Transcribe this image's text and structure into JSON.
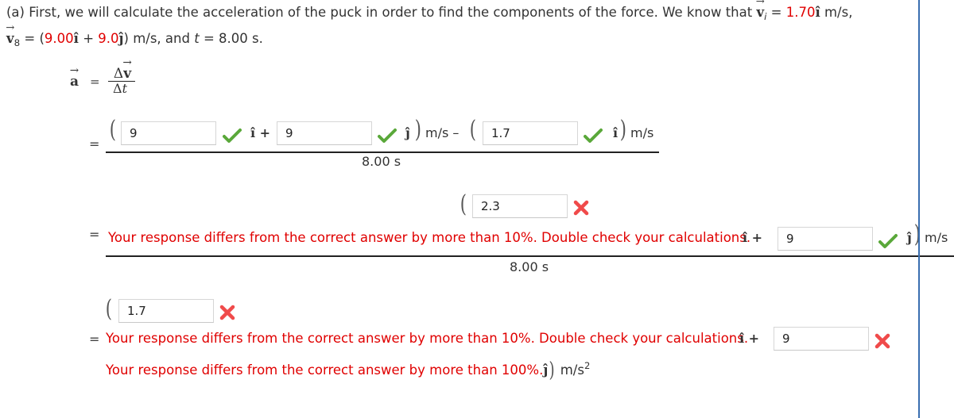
{
  "intro": {
    "part_label": "(a)",
    "line1_text": "First, we will calculate the acceleration of the puck in order to find the components of the force. We know that",
    "vi_symbol": "v",
    "vi_subscript": "i",
    "vi_equals": "=",
    "vi_value": "1.70",
    "vi_unit_vector": "î",
    "vi_units": "m/s,",
    "v8_symbol": "v",
    "v8_subscript": "8",
    "v8_equals": "= (",
    "v8_x_value": "9.00",
    "v8_x_unit": "î",
    "v8_plus": " + ",
    "v8_y_value": "9.0",
    "v8_y_unit": "ĵ",
    "v8_tail": ") m/s, and",
    "t_symbol": "t",
    "t_equals": "= 8.00 s."
  },
  "definition": {
    "a_symbol": "a",
    "equals": "=",
    "numerator": "Δv",
    "denominator_delta": "Δ",
    "denominator_t": "t"
  },
  "step1": {
    "equals": "=",
    "input1_value": "9",
    "input1_status": "correct",
    "i_hat_plus": "î +",
    "input2_value": "9",
    "input2_status": "correct",
    "j_hat": "ĵ",
    "ms_minus": "m/s –",
    "input3_value": "1.7",
    "input3_status": "correct",
    "i_hat": "î",
    "ms": "m/s",
    "denominator": "8.00 s"
  },
  "step2": {
    "equals": "=",
    "input1_value": "2.3",
    "input1_status": "incorrect",
    "feedback": "Your response differs from the correct answer by more than 10%. Double check your calculations.",
    "i_hat_plus": "î +",
    "input2_value": "9",
    "input2_status": "correct",
    "j_hat": "ĵ",
    "ms": "m/s",
    "denominator": "8.00 s"
  },
  "step3": {
    "equals": "=",
    "input1_value": "1.7",
    "input1_status": "incorrect",
    "feedback1": "Your response differs from the correct answer by more than 10%. Double check your calculations.",
    "i_hat_plus": "î +",
    "input2_value": "9",
    "input2_status": "incorrect",
    "feedback2": "Your response differs from the correct answer by more than 100%.",
    "j_hat": "ĵ",
    "units": "m/s",
    "units_exp": "2"
  },
  "colors": {
    "given_value_red": "#e00000",
    "feedback_red": "#e00000",
    "correct_green": "#5aa83a",
    "incorrect_red": "#f04a4a",
    "panel_border_blue": "#3a6fb0"
  }
}
